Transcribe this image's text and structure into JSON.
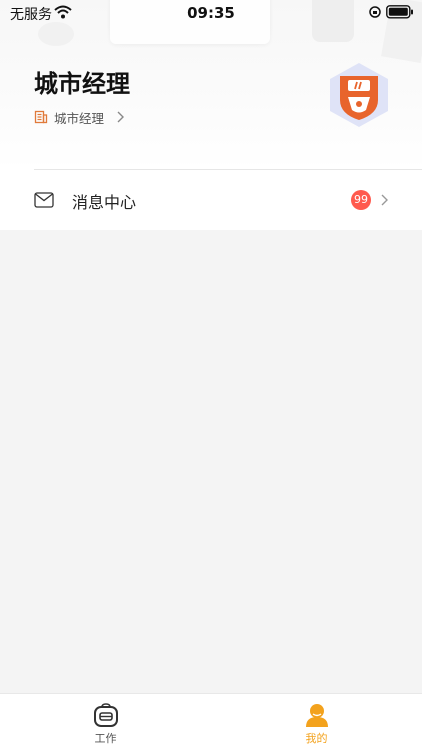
{
  "status_bar": {
    "carrier": "无服务",
    "time": "09:35"
  },
  "profile": {
    "title": "城市经理",
    "role": "城市经理"
  },
  "message_center": {
    "label": "消息中心",
    "badge_count": "99"
  },
  "tab_bar": {
    "tabs": [
      {
        "label": "工作",
        "icon": "briefcase-icon",
        "active": false
      },
      {
        "label": "我的",
        "icon": "person-icon",
        "active": true
      }
    ],
    "active_color": "#f3a21d",
    "inactive_color": "#555555"
  },
  "colors": {
    "badge": "#ff5a4e",
    "avatar_orange": "#e8642c",
    "avatar_bg": "#dfe3f7"
  }
}
